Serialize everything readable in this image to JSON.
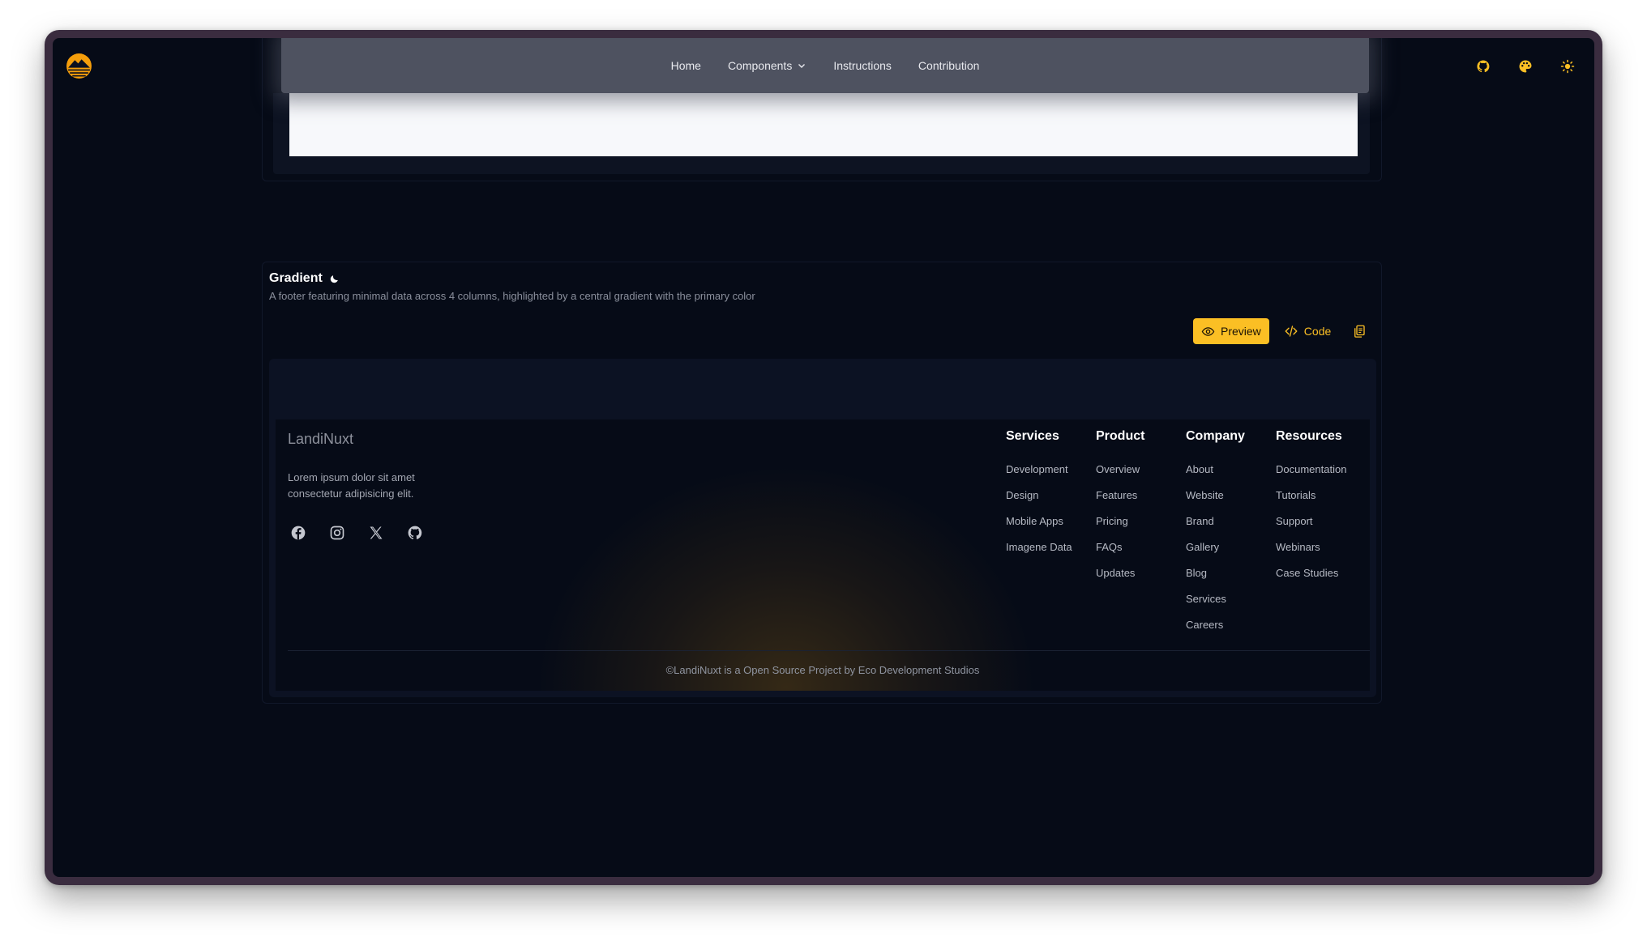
{
  "nav": {
    "links": [
      "Home",
      "Components",
      "Instructions",
      "Contribution"
    ]
  },
  "section": {
    "title": "Gradient",
    "description": "A footer featuring minimal data across 4 columns, highlighted by a central gradient with the primary color"
  },
  "toolbar": {
    "preview_label": "Preview",
    "code_label": "Code"
  },
  "footer": {
    "brand": "LandiNuxt",
    "tagline": "Lorem ipsum dolor sit amet consectetur adipisicing elit.",
    "columns": [
      {
        "title": "Services",
        "links": [
          "Development",
          "Design",
          "Mobile Apps",
          "Imagene Data"
        ]
      },
      {
        "title": "Product",
        "links": [
          "Overview",
          "Features",
          "Pricing",
          "FAQs",
          "Updates"
        ]
      },
      {
        "title": "Company",
        "links": [
          "About",
          "Website",
          "Brand",
          "Gallery",
          "Blog",
          "Services",
          "Careers"
        ]
      },
      {
        "title": "Resources",
        "links": [
          "Documentation",
          "Tutorials",
          "Support",
          "Webinars",
          "Case Studies"
        ]
      }
    ],
    "copyright": "©LandiNuxt is a Open Source Project by Eco Development Studios"
  },
  "colors": {
    "accent": "#fbbf24",
    "background": "#060b17",
    "navbar": "#4e5260"
  }
}
